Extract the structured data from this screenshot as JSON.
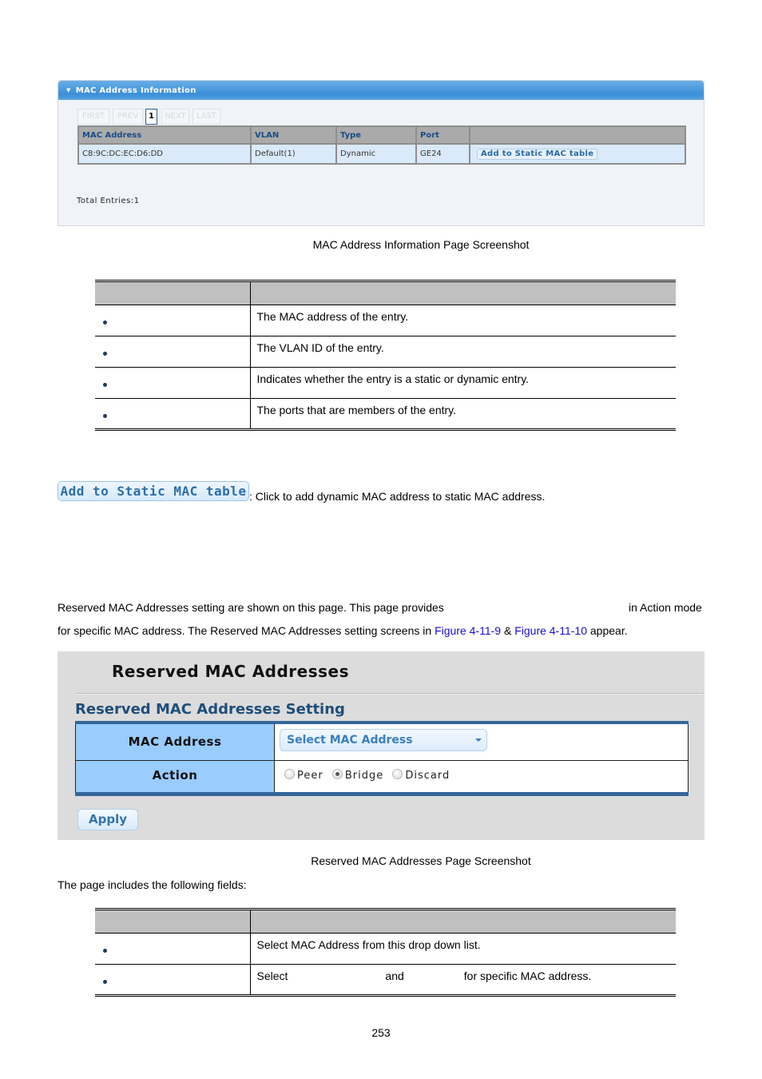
{
  "mac_info_panel": {
    "title": "MAC Address Information",
    "pager": {
      "first": "FIRST",
      "prev": "PREV",
      "current": "1",
      "next": "NEXT",
      "last": "LAST"
    },
    "columns": [
      "MAC Address",
      "VLAN",
      "Type",
      "Port",
      ""
    ],
    "rows": [
      {
        "mac": "C8:9C:DC:EC:D6:DD",
        "vlan": "Default(1)",
        "type": "Dynamic",
        "port": "GE24",
        "action": "Add to Static MAC table"
      }
    ],
    "total_entries": "Total Entries:1"
  },
  "caption1": "MAC Address Information Page Screenshot",
  "desc_table1": {
    "rows": [
      {
        "field": "",
        "description": "The MAC address of the entry."
      },
      {
        "field": "",
        "description": "The VLAN ID of the entry."
      },
      {
        "field": "",
        "description": "Indicates whether the entry is a static or dynamic entry."
      },
      {
        "field": "",
        "description": "The ports that are members of the entry."
      }
    ]
  },
  "add_static": {
    "button_label": "Add to Static MAC table",
    "description": ": Click to add dynamic MAC address to static MAC address."
  },
  "intro": {
    "line1_a": "Reserved MAC Addresses setting are shown on this page. This page provides",
    "line1_b": "in Action mode",
    "line2_a": "for specific MAC address. The Reserved MAC Addresses setting screens in ",
    "link1": "Figure 4-11-9",
    "amp": " & ",
    "link2": "Figure 4-11-10",
    "line2_b": " appear."
  },
  "reserved_panel": {
    "title": "Reserved MAC Addresses",
    "subtitle": "Reserved MAC Addresses Setting",
    "mac_label": "MAC Address",
    "mac_select_value": "Select MAC Address",
    "action_label": "Action",
    "actions": [
      {
        "label": "Peer",
        "checked": false
      },
      {
        "label": "Bridge",
        "checked": true
      },
      {
        "label": "Discard",
        "checked": false
      }
    ],
    "apply_label": "Apply"
  },
  "caption2": "Reserved MAC Addresses Page Screenshot",
  "fields_intro": "The page includes the following fields:",
  "desc_table2": {
    "rows": [
      {
        "field": "",
        "description": "Select MAC Address from this drop down list."
      },
      {
        "field": "",
        "desc_a": "Select",
        "desc_b": "and",
        "desc_c": "for specific MAC address."
      }
    ]
  },
  "page_number": "253"
}
